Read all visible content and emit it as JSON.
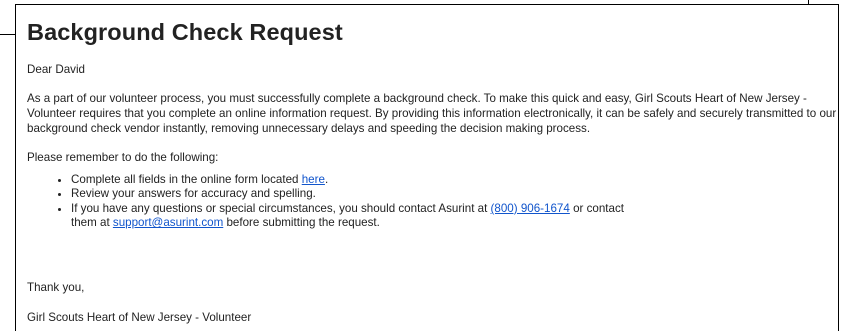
{
  "email": {
    "title": "Background Check Request",
    "greeting": "Dear David",
    "intro": "As a part of our volunteer process, you must successfully complete a background check. To make this quick and easy, Girl Scouts Heart of New Jersey - Volunteer requires that you complete an online information request. By providing this information electronically, it can be safely and securely transmitted to our background check vendor instantly, removing unnecessary delays and speeding the decision making process.",
    "reminder": "Please remember to do the following:",
    "tasks": {
      "item1_text": "Complete all fields in the online form located ",
      "item1_link": "here",
      "item1_suffix": ".",
      "item2_text": "Review your answers for accuracy and spelling.",
      "item3_text": "If you have any questions or special circumstances, you should contact Asurint at ",
      "item3_phone": "(800) 906-1674",
      "item3_middle": " or contact them at ",
      "item3_email": "support@asurint.com",
      "item3_suffix": " before submitting the request."
    },
    "closing": "Thank you,",
    "signature": "Girl Scouts Heart of New Jersey - Volunteer"
  },
  "colors": {
    "text": "#222222",
    "link": "#1155cc",
    "border": "#000000",
    "background": "#ffffff"
  }
}
